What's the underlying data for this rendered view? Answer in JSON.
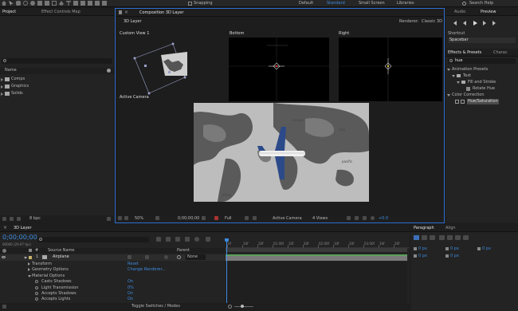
{
  "toolbar": {
    "snapping": "Snapping",
    "workspaces": [
      "Default",
      "Standard",
      "Small Screen",
      "Libraries"
    ],
    "search_help": "Search Help"
  },
  "project_panel": {
    "tabs": [
      "Project",
      "Effect Controls Map"
    ],
    "search_placeholder": "",
    "col_name": "Name",
    "items": [
      "Comps",
      "Graphics",
      "Solids"
    ],
    "bpc": "8 bpc"
  },
  "comp_panel": {
    "tab": "Composition 3D Layer",
    "comp_tab": "3D Layer",
    "renderer_label": "Renderer:",
    "renderer_value": "Classic 3D",
    "views": [
      "Custom View 1",
      "Bottom",
      "Right",
      "Active Camera"
    ],
    "zoom": "50%",
    "timecode": "0;00;00;00",
    "resolution": "Full",
    "camera": "Active Camera",
    "view_count": "4 Views",
    "offset": "+0.0"
  },
  "right_panel": {
    "tabs_top": [
      "Audio",
      "Preview"
    ],
    "shortcut_label": "Shortcut",
    "shortcut_value": "Spacebar",
    "tabs_fx": [
      "Effects & Presets",
      "Charac"
    ],
    "search_value": "hue",
    "tree": [
      "Animation Presets",
      "Text",
      "Fill and Stroke",
      "Rotate Hue",
      "Color Correction",
      "Hue/Saturation"
    ]
  },
  "timeline": {
    "tab": "3D Layer",
    "timecode": "0;00;00;00",
    "fps": "00000 (29.97 fps)",
    "col_source": "Source Name",
    "col_parent": "Parent",
    "layer_index": "1",
    "layer_name": "Airplane",
    "layer_parent": "None",
    "rows": [
      {
        "label": "Transform",
        "value": "Reset"
      },
      {
        "label": "Geometry Options",
        "value": "Change Renderer..."
      },
      {
        "label": "Material Options",
        "value": ""
      },
      {
        "label": "Casts Shadows",
        "value": "On"
      },
      {
        "label": "Light Transmission",
        "value": "0%"
      },
      {
        "label": "Accepts Shadows",
        "value": "On"
      },
      {
        "label": "Accepts Lights",
        "value": "On"
      }
    ],
    "footer": "Toggle Switches / Modes",
    "ruler": [
      "0f",
      "10f",
      "20f",
      "01:00f",
      "10f",
      "20f",
      "02:00f",
      "10f",
      "20f",
      "03:00f",
      "10f",
      "20f"
    ]
  },
  "paragraph_panel": {
    "tabs": [
      "Paragraph",
      "Align"
    ],
    "fields": [
      "0 px",
      "0 px",
      "0 px",
      "0 px",
      "0 px"
    ]
  },
  "map_labels": [
    "africa",
    "europe",
    "asia",
    "pacific"
  ]
}
